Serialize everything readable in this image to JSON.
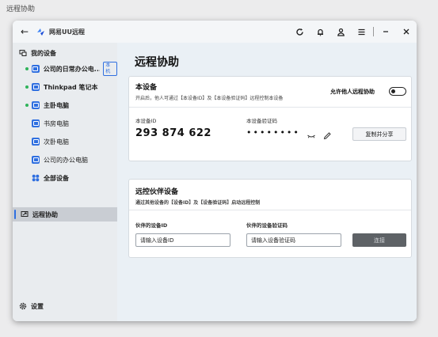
{
  "page_caption": "远程协助",
  "app": {
    "name": "网易UU远程"
  },
  "titlebar": {
    "icons": [
      "back-arrow-icon",
      "refresh-icon",
      "bell-icon",
      "user-icon",
      "menu-icon",
      "minimize-icon",
      "close-icon"
    ]
  },
  "sidebar": {
    "my_devices": "我的设备",
    "items": [
      {
        "label": "公司的日常办公电...",
        "online": true,
        "badge": "本机"
      },
      {
        "label": "Thinkpad 笔记本",
        "online": true
      },
      {
        "label": "主卧电脑",
        "online": true
      },
      {
        "label": "书房电脑",
        "online": false
      },
      {
        "label": "次卧电脑",
        "online": false
      },
      {
        "label": "公司的办公电脑",
        "online": false
      }
    ],
    "all_devices": "全部设备",
    "remote_assist": "远程协助",
    "settings": "设置",
    "accent_color": "#2f6fe0",
    "online_color": "#2fb35a"
  },
  "main": {
    "title": "远程协助",
    "this_device": {
      "title": "本设备",
      "desc": "开启后，他人可通过【本设备ID】及【本设备验证码】远程控制本设备",
      "allow_label": "允许他人远程协助",
      "allow_enabled": false,
      "id_label": "本设备ID",
      "id_value": "293 874 622",
      "code_label": "本设备验证码",
      "code_value": "••••••••",
      "copy_button": "复制并分享"
    },
    "remote_partner": {
      "title": "远控伙伴设备",
      "desc": "通过其他设备的【设备ID】及【设备验证码】启动远程控制",
      "partner_id_label": "伙伴的设备ID",
      "partner_id_placeholder": "请输入设备ID",
      "partner_code_label": "伙伴的设备验证码",
      "partner_code_placeholder": "请输入设备验证码",
      "connect_button": "连接"
    }
  }
}
